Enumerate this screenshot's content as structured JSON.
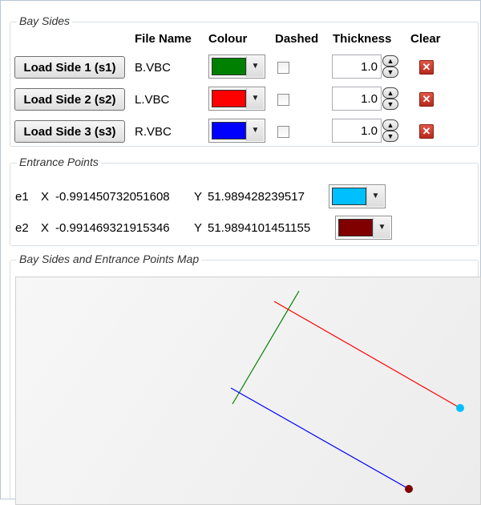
{
  "bay_sides": {
    "legend": "Bay Sides",
    "headers": {
      "file_name": "File Name",
      "colour": "Colour",
      "dashed": "Dashed",
      "thickness": "Thickness",
      "clear": "Clear"
    },
    "rows": [
      {
        "button": "Load Side 1 (s1)",
        "file": "B.VBC",
        "colour": "#008000",
        "dashed": false,
        "thickness": "1.0"
      },
      {
        "button": "Load Side 2 (s2)",
        "file": "L.VBC",
        "colour": "#ff0000",
        "dashed": false,
        "thickness": "1.0"
      },
      {
        "button": "Load Side 3 (s3)",
        "file": "R.VBC",
        "colour": "#0000ff",
        "dashed": false,
        "thickness": "1.0"
      }
    ]
  },
  "entrance_points": {
    "legend": "Entrance Points",
    "points": [
      {
        "id": "e1",
        "x_label": "X",
        "x": "-0.991450732051608",
        "y_label": "Y",
        "y": "51.989428239517",
        "colour": "#00bfff"
      },
      {
        "id": "e2",
        "x_label": "X",
        "x": "-0.991469321915346",
        "y_label": "Y",
        "y": "51.9894101451155",
        "colour": "#800000"
      }
    ]
  },
  "map": {
    "legend": "Bay Sides and Entrance Points Map"
  },
  "icons": {
    "dropdown": "chevron-down-icon",
    "spin_up": "chevron-up-icon",
    "spin_down": "chevron-down-icon",
    "clear": "close-icon"
  }
}
